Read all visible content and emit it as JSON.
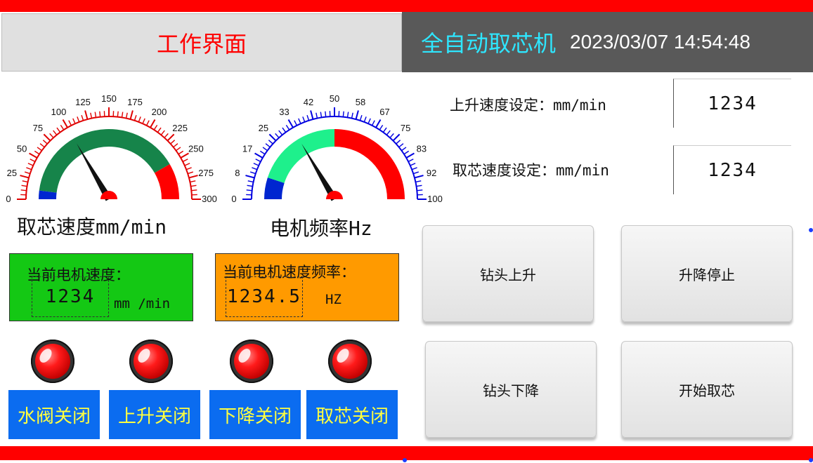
{
  "header": {
    "screen_title": "工作界面",
    "machine_name": "全自动取芯机",
    "datetime": "2023/03/07 14:54:48"
  },
  "colors": {
    "accent_red": "#ff0000",
    "header_dark": "#595959",
    "machine_cyan": "#2ee6ff",
    "status_blue": "#0b6cf0",
    "status_text": "#ffff40",
    "panel_green": "#14c814",
    "panel_orange": "#ff9a00"
  },
  "gauges": [
    {
      "id": "speed",
      "label": "取芯速度mm/min",
      "min": 0,
      "max": 300,
      "ticks": [
        "0",
        "25",
        "50",
        "75",
        "100",
        "125",
        "150",
        "175",
        "200",
        "225",
        "250",
        "275",
        "300"
      ],
      "value": 100,
      "scale_color": "#e00000",
      "bands": [
        {
          "from": 0,
          "to": 12,
          "color": "#0026d0"
        },
        {
          "from": 12,
          "to": 250,
          "color": "#16844a"
        },
        {
          "from": 250,
          "to": 300,
          "color": "#ff0000"
        }
      ]
    },
    {
      "id": "freq",
      "label": "电机频率Hz",
      "min": 0,
      "max": 100,
      "ticks": [
        "0",
        "8",
        "17",
        "25",
        "33",
        "42",
        "50",
        "58",
        "67",
        "75",
        "83",
        "92",
        "100"
      ],
      "value": 33,
      "scale_color": "#0000e0",
      "bands": [
        {
          "from": 0,
          "to": 10,
          "color": "#0026d0"
        },
        {
          "from": 10,
          "to": 50,
          "color": "#1ef08c"
        },
        {
          "from": 50,
          "to": 100,
          "color": "#ff0000"
        }
      ]
    }
  ],
  "settings": {
    "rise_label": "上升速度设定：mm/min",
    "rise_value": "1234",
    "core_label": "取芯速度设定：mm/min",
    "core_value": "1234"
  },
  "panels": {
    "speed_title": "当前电机速度：",
    "speed_value": "1234",
    "speed_unit": "mm /min",
    "freq_title": "当前电机速度频率：",
    "freq_value": "1234.5",
    "freq_unit": "HZ"
  },
  "status": [
    {
      "label": "水阀关闭",
      "lamp": "red"
    },
    {
      "label": "上升关闭",
      "lamp": "red"
    },
    {
      "label": "下降关闭",
      "lamp": "red"
    },
    {
      "label": "取芯关闭",
      "lamp": "red"
    }
  ],
  "buttons": {
    "drill_up": "钻头上升",
    "lift_stop": "升降停止",
    "drill_down": "钻头下降",
    "start_core": "开始取芯"
  }
}
